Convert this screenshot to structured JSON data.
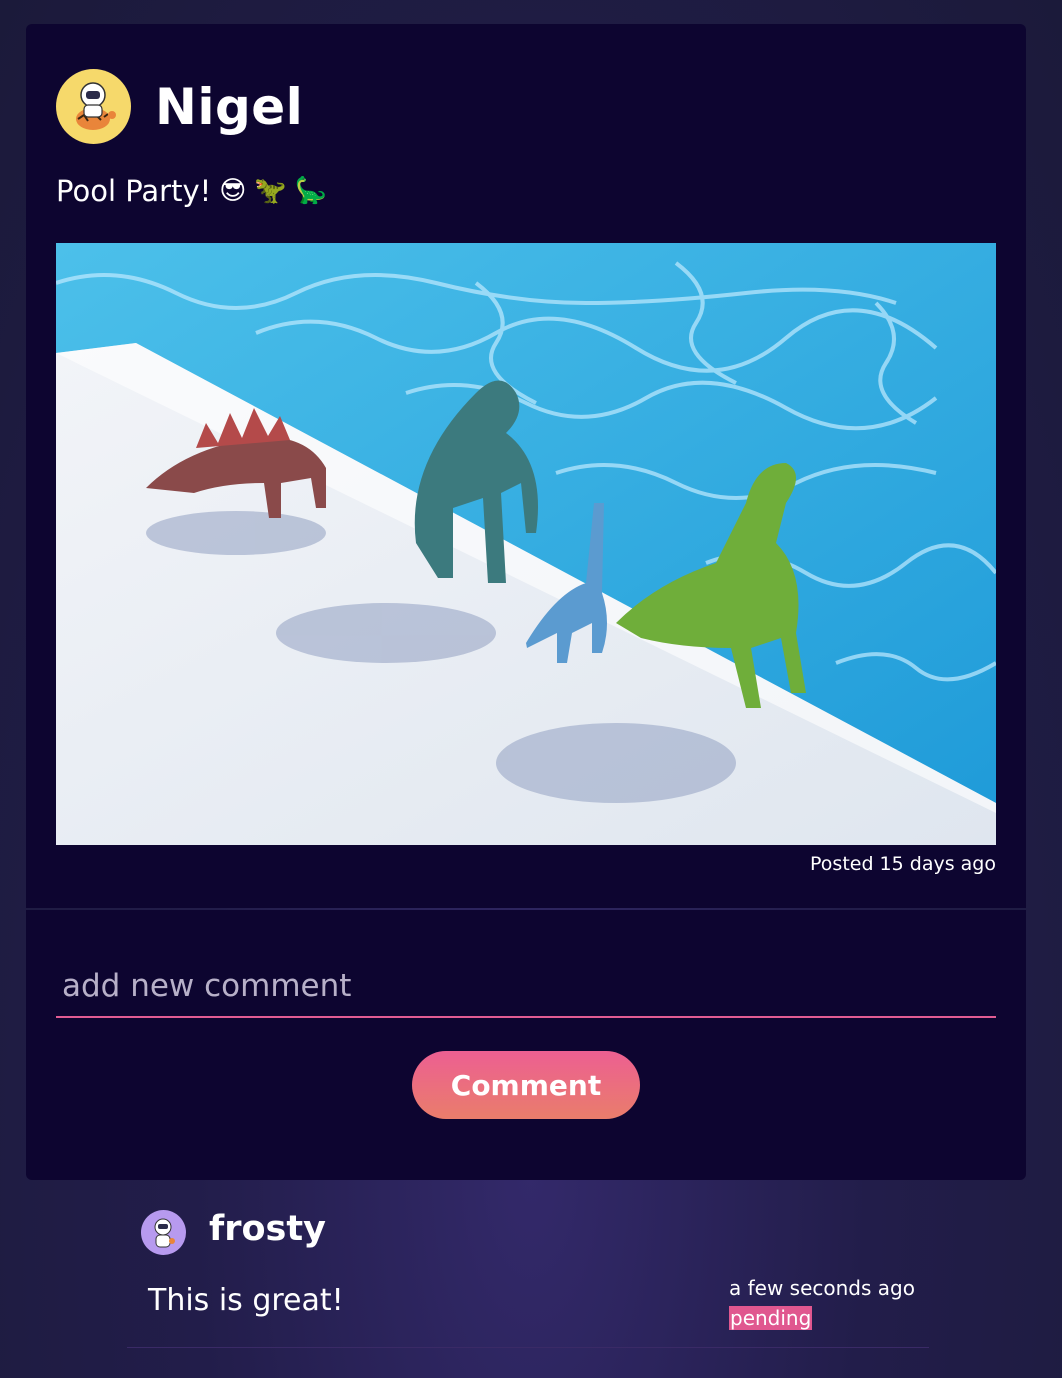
{
  "post": {
    "author": "Nigel",
    "caption_text": "Pool Party!",
    "caption_emojis": [
      "😎",
      "🦖",
      "🦕"
    ],
    "posted": "Posted 15 days ago",
    "image_icon": "dinosaur-toys-pool-photo"
  },
  "comment_form": {
    "placeholder": "add new comment",
    "button_label": "Comment"
  },
  "comments": [
    {
      "author": "frosty",
      "text": "This is great!",
      "time": "a few seconds ago",
      "status": "pending"
    }
  ],
  "colors": {
    "card_bg": "#0d0530",
    "accent_pink": "#e15c93",
    "button_gradient_start": "#ec5f92",
    "button_gradient_end": "#ea7d6b",
    "avatar_yellow": "#f6d96b",
    "avatar_purple": "#b79aef"
  }
}
